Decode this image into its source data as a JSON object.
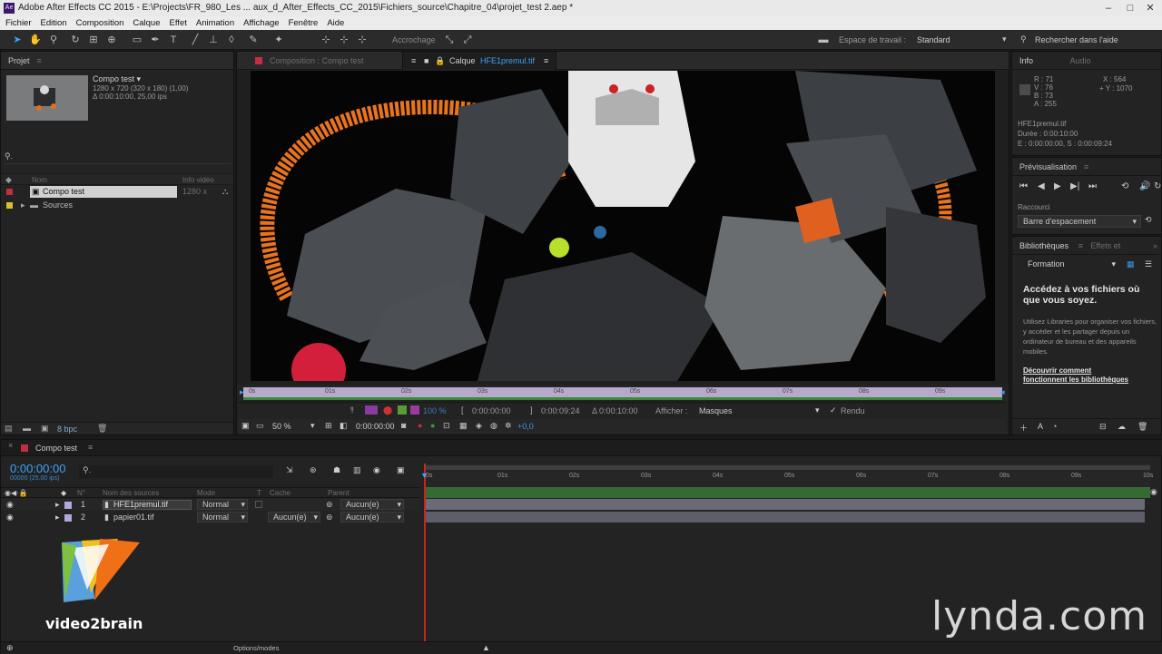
{
  "window": {
    "title": "Adobe After Effects CC 2015 - E:\\Projects\\FR_980_Les ... aux_d_After_Effects_CC_2015\\Fichiers_source\\Chapitre_04\\projet_test 2.aep *",
    "app_icon": "Ae",
    "minimize": "–",
    "maximize": "□",
    "close": "✕"
  },
  "menu": [
    "Fichier",
    "Edition",
    "Composition",
    "Calque",
    "Effet",
    "Animation",
    "Affichage",
    "Fenêtre",
    "Aide"
  ],
  "toolbar": {
    "snap_label": "Accrochage",
    "workspace_label": "Espace de travail :",
    "workspace_value": "Standard",
    "search_placeholder": "Rechercher dans l'aide"
  },
  "project": {
    "title": "Projet",
    "comp_name": "Compo test ▾",
    "comp_info1": "1280 x 720  (320 x 180) (1,00)",
    "comp_info2": "Δ 0:00:10:00, 25,00 ips",
    "col_name": "Nom",
    "col_info": "Info vidéo",
    "items": [
      {
        "name": "Compo test",
        "info": "1280 x"
      },
      {
        "name": "Sources",
        "info": ""
      }
    ],
    "bpc": "8 bpc"
  },
  "comp_tab": {
    "label": "Composition : Compo test"
  },
  "layer_tab": {
    "prefix": "Calque",
    "name": "HFE1premul.tif"
  },
  "ruler": {
    "ticks": [
      "0s",
      "01s",
      "02s",
      "03s",
      "04s",
      "05s",
      "06s",
      "07s",
      "08s",
      "09s"
    ]
  },
  "viewer_controls": {
    "zoom": "50 %",
    "time1": "0:00:00:00",
    "time2": "0:00:00:00",
    "time3": "0:00:09:24",
    "time4": "Δ 0:00:10:00",
    "afficher_label": "Afficher :",
    "afficher_value": "Masques",
    "rendu": "Rendu",
    "offset": "+0,0",
    "pct": "100 %"
  },
  "info": {
    "tab1": "Info",
    "tab2": "Audio",
    "r": "R : 71",
    "g": "V : 76",
    "b": "B : 73",
    "a": "A : 255",
    "x": "X : 564",
    "y": "+ Y : 1070",
    "file": "HFE1premul.tif",
    "duree": "Durée : 0:00:10:00",
    "ES": "E : 0:00:00:00, S : 0:00:09:24"
  },
  "preview": {
    "title": "Prévisualisation",
    "shortcut_label": "Raccourci",
    "shortcut_value": "Barre d'espacement"
  },
  "libraries": {
    "tab1": "Bibliothèques",
    "tab2": "Effets et",
    "dropdown": "Formation",
    "heading": "Accédez à vos fichiers où que vous soyez.",
    "body": "Utilisez Libraries pour organiser vos fichiers, y accéder et les partager depuis un ordinateur de bureau et des appareils mobiles.",
    "link": "Découvrir comment fonctionnent les bibliothèques"
  },
  "timeline": {
    "tab": "Compo test",
    "timecode": "0:00:00:00",
    "fps": "00000 (25.00 ips)",
    "cols": {
      "num": "N°",
      "name": "Nom des sources",
      "mode": "Mode",
      "t": "T",
      "cache": "Cache",
      "parent": "Parent"
    },
    "layers": [
      {
        "num": "1",
        "name": "HFE1premul.tif",
        "mode": "Normal",
        "cache": "",
        "parent": "Aucun(e)"
      },
      {
        "num": "2",
        "name": "papier01.tif",
        "mode": "Normal",
        "cache": "Aucun(e)",
        "parent": "Aucun(e)"
      }
    ],
    "ticks": [
      "0s",
      "01s",
      "02s",
      "03s",
      "04s",
      "05s",
      "06s",
      "07s",
      "08s",
      "09s",
      "10s"
    ],
    "toggle": "Options/modes"
  },
  "branding": {
    "v2b": "video2brain",
    "lynda": "lynda.com"
  },
  "colors": {
    "accent": "#3aa2ff",
    "track_green": "#3a8a3a",
    "layer_bar": "#6b6b78",
    "playhead": "#cc2222"
  }
}
